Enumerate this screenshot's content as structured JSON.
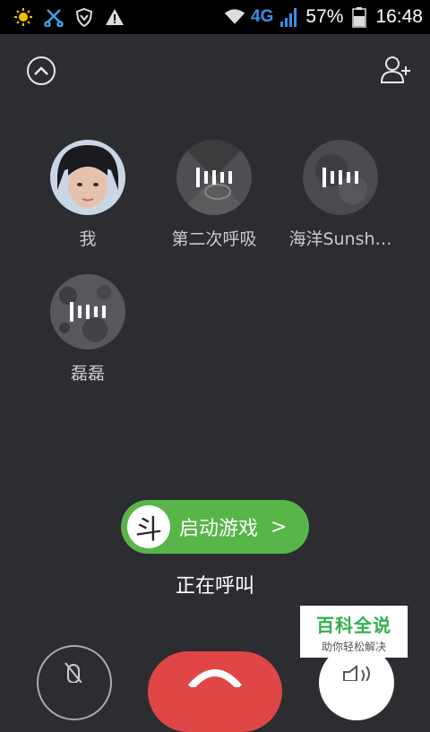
{
  "status_bar": {
    "battery_percent": "57%",
    "time": "16:48",
    "network": "4G",
    "icons": [
      "brightness-icon",
      "scissors-icon",
      "shield-icon",
      "warning-icon",
      "wifi-icon",
      "signal-icon",
      "battery-icon"
    ]
  },
  "header": {
    "collapse_icon": "chevron-up-icon",
    "add_member_icon": "add-person-icon"
  },
  "participants": [
    {
      "name": "我",
      "speaking": false
    },
    {
      "name": "第二次呼吸",
      "speaking": true
    },
    {
      "name": "海洋Sunsh…",
      "speaking": true
    },
    {
      "name": "磊磊",
      "speaking": true
    }
  ],
  "game_launcher": {
    "logo_char": "斗",
    "label": "启动游戏",
    "arrow": ">"
  },
  "call_status": "正在呼叫",
  "controls": {
    "mute_icon": "microphone-off-icon",
    "hangup_icon": "phone-hangup-icon",
    "speaker_icon": "speaker-icon"
  },
  "watermark": {
    "title": "百科全说",
    "subtitle": "助你轻松解决"
  },
  "colors": {
    "background": "#2b2d30",
    "game_green": "#58b548",
    "hangup_red": "#e04646",
    "network_blue": "#3b8ee6",
    "watermark_green": "#2eb14a"
  }
}
